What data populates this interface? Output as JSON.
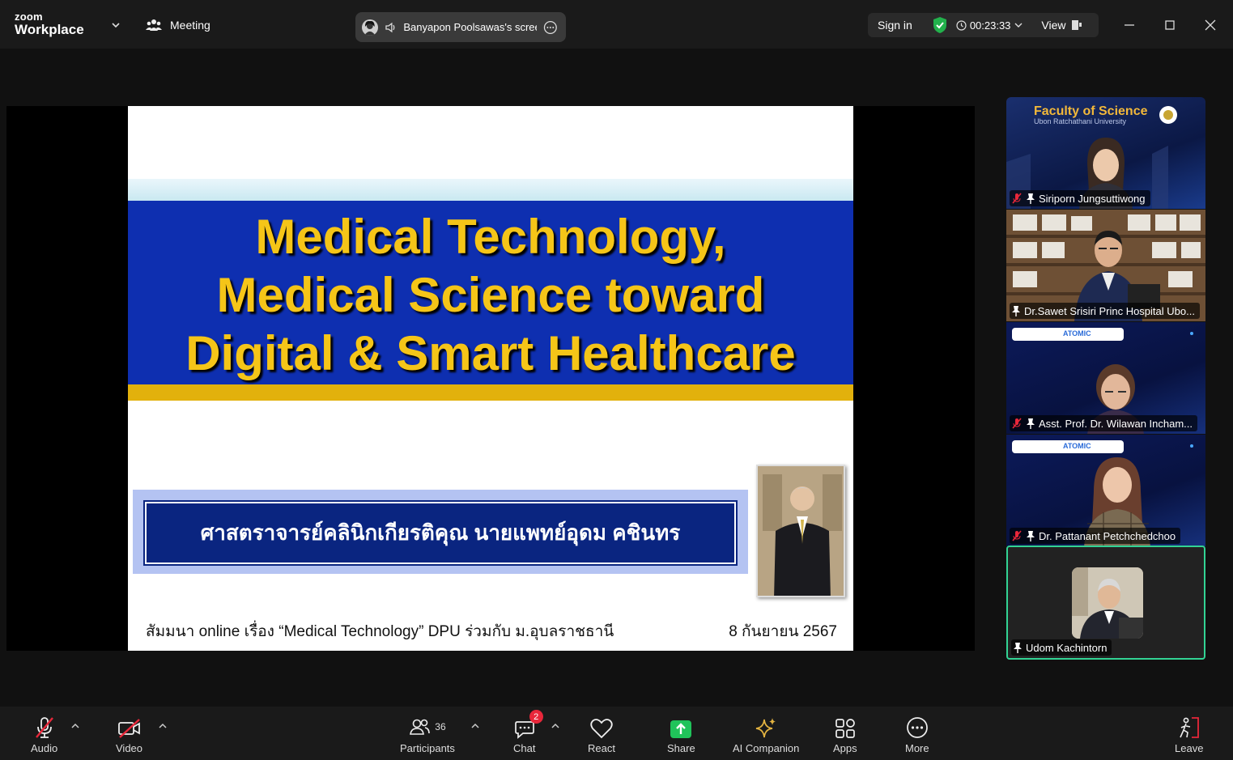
{
  "app": {
    "brand_top": "zoom",
    "brand_bottom": "Workplace",
    "meeting_label": "Meeting"
  },
  "share_pill": {
    "label": "Banyapon Poolsawas's scree"
  },
  "status": {
    "sign_in": "Sign in",
    "timer": "00:23:33",
    "view": "View"
  },
  "slide": {
    "title_lines": [
      "Medical Technology,",
      "Medical Science toward",
      "Digital & Smart Healthcare"
    ],
    "speaker_name": "ศาสตราจารย์คลินิกเกียรติคุณ นายแพทย์อุดม คชินทร",
    "footer_left": "สัมมนา online เรื่อง “Medical Technology” DPU ร่วมกับ ม.อุบลราชธานี",
    "footer_right": "8 กันยายน 2567",
    "colors": {
      "title": "#f5c518",
      "band": "#0e2fb0",
      "gold": "#e2b10c"
    }
  },
  "tiles": [
    {
      "name": "Siriporn Jungsuttiwong",
      "muted": true,
      "banner_title": "Faculty of Science",
      "banner_sub": "Ubon Ratchathani University"
    },
    {
      "name": "Dr.Sawet Srisiri Princ Hospital Ubo...",
      "muted": false
    },
    {
      "name": "Asst. Prof. Dr. Wilawan Incham...",
      "muted": true,
      "banner": "ATOMIC"
    },
    {
      "name": "Dr. Pattanant Petchchedchoo",
      "muted": true,
      "banner": "ATOMIC"
    },
    {
      "name": "Udom Kachintorn",
      "muted": false,
      "active": true
    }
  ],
  "toolbar": {
    "audio": "Audio",
    "video": "Video",
    "participants": "Participants",
    "participants_count": "36",
    "chat": "Chat",
    "chat_badge": "2",
    "react": "React",
    "share": "Share",
    "ai_companion": "AI Companion",
    "apps": "Apps",
    "more": "More",
    "leave": "Leave"
  }
}
